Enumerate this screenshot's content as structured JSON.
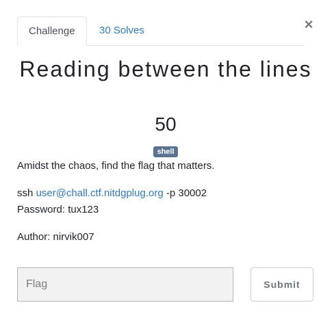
{
  "modal": {
    "close_glyph": "×"
  },
  "tabs": [
    {
      "label": "Challenge",
      "active": true
    },
    {
      "label": "30 Solves",
      "active": false
    }
  ],
  "challenge": {
    "title": "Reading between the lines",
    "points": "50",
    "category_badge": "shell",
    "description": "Amidst the chaos, find the flag that matters.",
    "ssh_prefix": "ssh ",
    "ssh_link": "user@chall.ctf.nitdgplug.org",
    "ssh_suffix": " -p 30002",
    "password_line": "Password: tux123",
    "author_line": "Author: nirvik007"
  },
  "form": {
    "flag_placeholder": "Flag",
    "flag_value": "",
    "submit_label": "Submit"
  },
  "colors": {
    "link": "#337ab7",
    "badge": "#5b7290",
    "input_bg": "#f2f2f2"
  }
}
